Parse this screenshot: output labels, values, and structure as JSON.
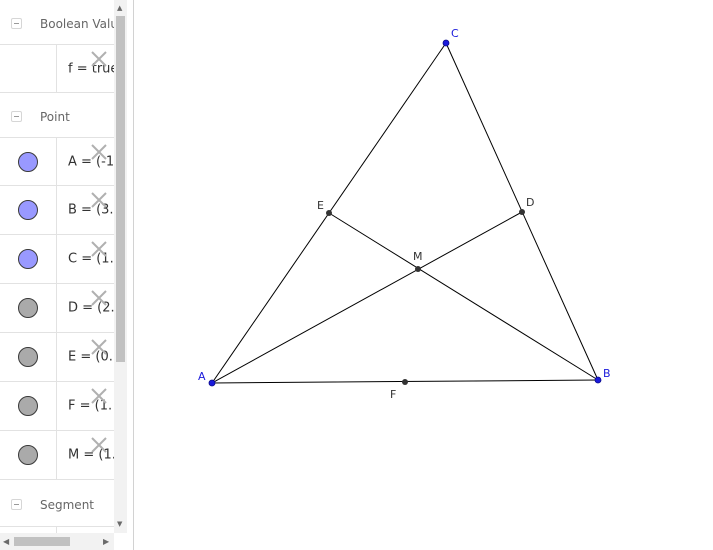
{
  "groups": {
    "boolean": "Boolean Value",
    "point": "Point",
    "segment": "Segment"
  },
  "objects": {
    "f": "f = true",
    "A": "A = (-1.",
    "B": "B = (3.",
    "C": "C = (1.",
    "D": "D = (2.",
    "E": "E = (0.",
    "F": "F = (1.",
    "M": "M = (1."
  },
  "canvas_labels": {
    "A": "A",
    "B": "B",
    "C": "C",
    "D": "D",
    "E": "E",
    "F": "F",
    "M": "M"
  },
  "colors": {
    "free_point": "#1a1adb",
    "dependent_point": "#333333",
    "free_marble": "#9999ff",
    "dependent_marble": "#aaaaaa",
    "segment": "#000000"
  },
  "icons": {
    "delete": "close-icon",
    "collapse": "minus-icon"
  }
}
